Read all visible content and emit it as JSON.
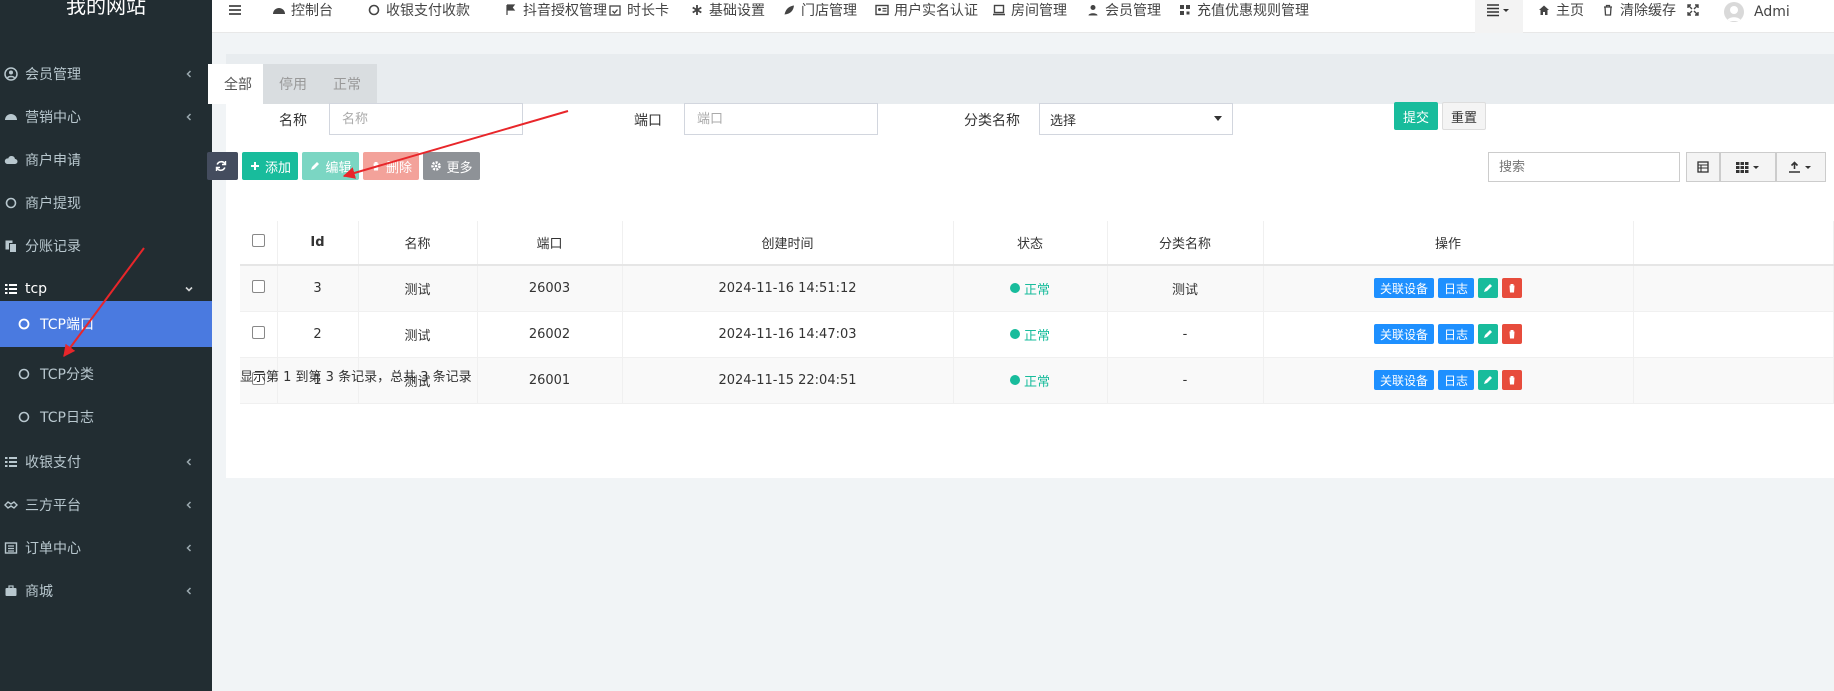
{
  "brand": "我的网站",
  "sidebar": {
    "items": [
      {
        "label": "会员管理"
      },
      {
        "label": "营销中心"
      },
      {
        "label": "商户申请"
      },
      {
        "label": "商户提现"
      },
      {
        "label": "分账记录"
      },
      {
        "label": "tcp"
      },
      {
        "label": "TCP端口"
      },
      {
        "label": "TCP分类"
      },
      {
        "label": "TCP日志"
      },
      {
        "label": "收银支付"
      },
      {
        "label": "三方平台"
      },
      {
        "label": "订单中心"
      },
      {
        "label": "商城"
      }
    ]
  },
  "topbar": {
    "items": [
      {
        "label": "控制台"
      },
      {
        "label": "收银支付收款"
      },
      {
        "label": "抖音授权管理"
      },
      {
        "label": "时长卡"
      },
      {
        "label": "基础设置"
      },
      {
        "label": "门店管理"
      },
      {
        "label": "用户实名认证"
      },
      {
        "label": "房间管理"
      },
      {
        "label": "会员管理"
      },
      {
        "label": "充值优惠规则管理"
      }
    ],
    "home": "主页",
    "clear_cache": "清除缓存",
    "user": "Admi"
  },
  "tabs": [
    {
      "label": "全部"
    },
    {
      "label": "停用"
    },
    {
      "label": "正常"
    }
  ],
  "filters": {
    "name_label": "名称",
    "name_placeholder": "名称",
    "port_label": "端口",
    "port_placeholder": "端口",
    "category_label": "分类名称",
    "category_value": "选择",
    "submit": "提交",
    "reset": "重置"
  },
  "toolbar": {
    "add": "添加",
    "edit": "编辑",
    "delete": "删除",
    "more": "更多",
    "search_placeholder": "搜索"
  },
  "table": {
    "columns": [
      "Id",
      "名称",
      "端口",
      "创建时间",
      "状态",
      "分类名称",
      "操作"
    ],
    "rows": [
      {
        "id": "3",
        "name": "测试",
        "port": "26003",
        "created": "2024-11-16 14:51:12",
        "status": "正常",
        "category": "测试"
      },
      {
        "id": "2",
        "name": "测试",
        "port": "26002",
        "created": "2024-11-16 14:47:03",
        "status": "正常",
        "category": "-"
      },
      {
        "id": "1",
        "name": "测试",
        "port": "26001",
        "created": "2024-11-15 22:04:51",
        "status": "正常",
        "category": "-"
      }
    ],
    "op_device": "关联设备",
    "op_log": "日志"
  },
  "summary": "显示第 1 到第 3 条记录，总共 3 条记录",
  "colors": {
    "sidebar_bg": "#222d32",
    "active": "#4a7ae0",
    "primary_green": "#18bc9c",
    "blue": "#1e90ff",
    "red": "#e74c3c"
  }
}
